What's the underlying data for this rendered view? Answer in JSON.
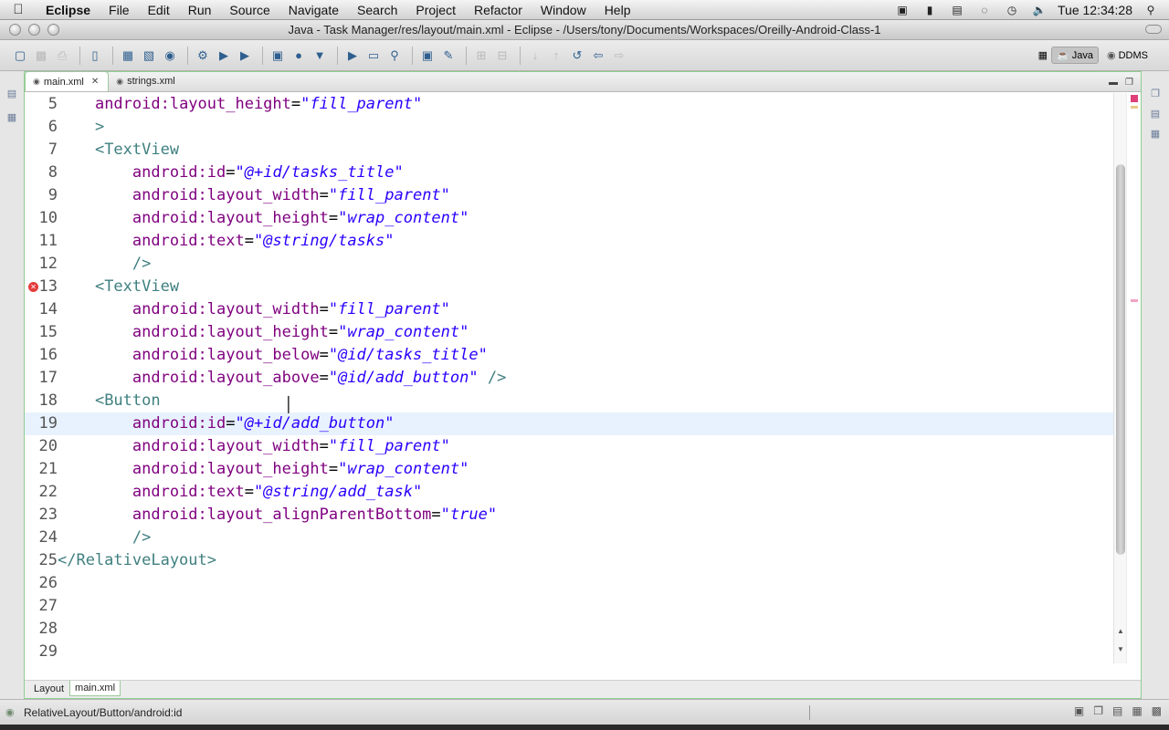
{
  "menubar": {
    "app": "Eclipse",
    "items": [
      "File",
      "Edit",
      "Run",
      "Source",
      "Navigate",
      "Search",
      "Project",
      "Refactor",
      "Window",
      "Help"
    ],
    "clock": "Tue 12:34:28"
  },
  "window": {
    "title": "Java - Task Manager/res/layout/main.xml - Eclipse - /Users/tony/Documents/Workspaces/Oreilly-Android-Class-1"
  },
  "perspectives": [
    {
      "label": "Java",
      "active": true
    },
    {
      "label": "DDMS",
      "active": false
    }
  ],
  "editor": {
    "tabs": [
      {
        "label": "main.xml",
        "active": true
      },
      {
        "label": "strings.xml",
        "active": false
      }
    ],
    "current_line": 19,
    "error_line": 13,
    "lines": [
      {
        "n": "5",
        "indent": "    ",
        "parts": [
          [
            "attr",
            "android:layout_height"
          ],
          [
            "plain",
            "="
          ],
          [
            "val",
            "\"fill_parent\""
          ]
        ]
      },
      {
        "n": "6",
        "indent": "    ",
        "parts": [
          [
            "tag",
            ">"
          ]
        ]
      },
      {
        "n": "7",
        "indent": "    ",
        "parts": [
          [
            "tag",
            "<TextView"
          ]
        ]
      },
      {
        "n": "8",
        "indent": "        ",
        "parts": [
          [
            "attr",
            "android:id"
          ],
          [
            "plain",
            "="
          ],
          [
            "val",
            "\"@+id/tasks_title\""
          ]
        ]
      },
      {
        "n": "9",
        "indent": "        ",
        "parts": [
          [
            "attr",
            "android:layout_width"
          ],
          [
            "plain",
            "="
          ],
          [
            "val",
            "\"fill_parent\""
          ]
        ]
      },
      {
        "n": "10",
        "indent": "        ",
        "parts": [
          [
            "attr",
            "android:layout_height"
          ],
          [
            "plain",
            "="
          ],
          [
            "val",
            "\"wrap_content\""
          ]
        ]
      },
      {
        "n": "11",
        "indent": "        ",
        "parts": [
          [
            "attr",
            "android:text"
          ],
          [
            "plain",
            "="
          ],
          [
            "val",
            "\"@string/tasks\""
          ]
        ]
      },
      {
        "n": "12",
        "indent": "        ",
        "parts": [
          [
            "tag",
            "/>"
          ]
        ]
      },
      {
        "n": "13",
        "indent": "    ",
        "parts": [
          [
            "tag",
            "<TextView"
          ]
        ]
      },
      {
        "n": "14",
        "indent": "        ",
        "parts": [
          [
            "attr",
            "android:layout_width"
          ],
          [
            "plain",
            "="
          ],
          [
            "val",
            "\"fill_parent\""
          ]
        ]
      },
      {
        "n": "15",
        "indent": "        ",
        "parts": [
          [
            "attr",
            "android:layout_height"
          ],
          [
            "plain",
            "="
          ],
          [
            "val",
            "\"wrap_content\""
          ]
        ]
      },
      {
        "n": "16",
        "indent": "        ",
        "parts": [
          [
            "attr",
            "android:layout_below"
          ],
          [
            "plain",
            "="
          ],
          [
            "val",
            "\"@id/tasks_title\""
          ]
        ]
      },
      {
        "n": "17",
        "indent": "        ",
        "parts": [
          [
            "attr",
            "android:layout_above"
          ],
          [
            "plain",
            "="
          ],
          [
            "val",
            "\"@id/add_button\""
          ],
          [
            "plain",
            " "
          ],
          [
            "tag",
            "/>"
          ]
        ]
      },
      {
        "n": "18",
        "indent": "    ",
        "parts": [
          [
            "tag",
            "<Button"
          ]
        ]
      },
      {
        "n": "19",
        "indent": "        ",
        "parts": [
          [
            "attr",
            "android:id"
          ],
          [
            "plain",
            "="
          ],
          [
            "val",
            "\"@+id/add_button\""
          ]
        ]
      },
      {
        "n": "20",
        "indent": "        ",
        "parts": [
          [
            "attr",
            "android:layout_width"
          ],
          [
            "plain",
            "="
          ],
          [
            "val",
            "\"fill_parent\""
          ]
        ]
      },
      {
        "n": "21",
        "indent": "        ",
        "parts": [
          [
            "attr",
            "android:layout_height"
          ],
          [
            "plain",
            "="
          ],
          [
            "val",
            "\"wrap_content\""
          ]
        ]
      },
      {
        "n": "22",
        "indent": "        ",
        "parts": [
          [
            "attr",
            "android:text"
          ],
          [
            "plain",
            "="
          ],
          [
            "val",
            "\"@string/add_task\""
          ]
        ]
      },
      {
        "n": "23",
        "indent": "        ",
        "parts": [
          [
            "attr",
            "android:layout_alignParentBottom"
          ],
          [
            "plain",
            "="
          ],
          [
            "val",
            "\"true\""
          ]
        ]
      },
      {
        "n": "24",
        "indent": "        ",
        "parts": [
          [
            "tag",
            "/>"
          ]
        ]
      },
      {
        "n": "25",
        "indent": "",
        "parts": [
          [
            "tag",
            "</RelativeLayout>"
          ]
        ]
      },
      {
        "n": "26",
        "indent": "",
        "parts": []
      },
      {
        "n": "27",
        "indent": "",
        "parts": []
      },
      {
        "n": "28",
        "indent": "",
        "parts": []
      },
      {
        "n": "29",
        "indent": "",
        "parts": []
      }
    ],
    "bottom_tabs": [
      {
        "label": "Layout",
        "active": false
      },
      {
        "label": "main.xml",
        "active": true
      }
    ]
  },
  "status": {
    "path": "RelativeLayout/Button/android:id"
  },
  "colors": {
    "tag": "#3f7f7f",
    "attribute": "#7f007f",
    "value": "#2a00ff",
    "error": "#e33b3b",
    "current_line": "#e8f2fe"
  }
}
